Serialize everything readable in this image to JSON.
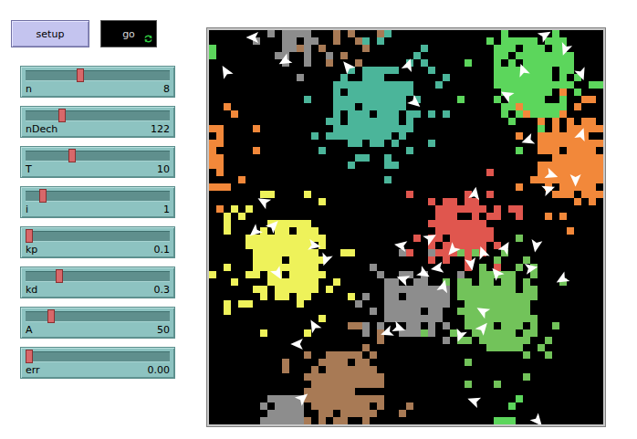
{
  "buttons": [
    {
      "label": "setup",
      "kind": "once",
      "pressed": false
    },
    {
      "label": "go",
      "kind": "forever",
      "pressed": true
    }
  ],
  "sliders": [
    {
      "label": "n",
      "value": "8",
      "level": 0.37
    },
    {
      "label": "nDech",
      "value": "122",
      "level": 0.24
    },
    {
      "label": "T",
      "value": "10",
      "level": 0.31
    },
    {
      "label": "i",
      "value": "1",
      "level": 0.1
    },
    {
      "label": "kp",
      "value": "0.1",
      "level": 0.0
    },
    {
      "label": "kd",
      "value": "0.3",
      "level": 0.22
    },
    {
      "label": "A",
      "value": "50",
      "level": 0.16
    },
    {
      "label": "err",
      "value": "0.00",
      "level": 0.0
    }
  ],
  "world": {
    "clusters": [
      {
        "color": "#8d8d8d",
        "center": [
          11,
          1
        ],
        "radius": 3
      },
      {
        "color": "#4bb59a",
        "center": [
          22,
          10
        ],
        "radius": 6
      },
      {
        "color": "#5cd65c",
        "center": [
          44,
          5.5
        ],
        "radius": 6
      },
      {
        "color": "#f2883a",
        "center": [
          49.5,
          17
        ],
        "radius": 6
      },
      {
        "color": "#eef25a",
        "center": [
          10,
          31
        ],
        "radius": 6
      },
      {
        "color": "#e0564e",
        "center": [
          34,
          27
        ],
        "radius": 5
      },
      {
        "color": "#8d8d8d",
        "center": [
          28,
          37
        ],
        "radius": 4.5
      },
      {
        "color": "#72c35a",
        "center": [
          39,
          37.5
        ],
        "radius": 6
      },
      {
        "color": "#a87a55",
        "center": [
          18,
          49
        ],
        "radius": 5.5
      },
      {
        "color": "#8d8d8d",
        "center": [
          10,
          51.5
        ],
        "radius": 3
      },
      {
        "color": "#5cd65c",
        "center": [
          40,
          53.5
        ],
        "radius": 2
      }
    ],
    "turtles": [
      {
        "x": 6,
        "y": 1,
        "heading": 270
      },
      {
        "x": 10.4,
        "y": 4.2,
        "heading": 240
      },
      {
        "x": 2.3,
        "y": 5.7,
        "heading": 330
      },
      {
        "x": 19,
        "y": 5,
        "heading": 320
      },
      {
        "x": 27.3,
        "y": 4.8,
        "heading": 20
      },
      {
        "x": 28.2,
        "y": 9.9,
        "heading": 130
      },
      {
        "x": 46,
        "y": 0.7,
        "heading": 60
      },
      {
        "x": 48.8,
        "y": 2.6,
        "heading": 200
      },
      {
        "x": 43,
        "y": 5.5,
        "heading": 340
      },
      {
        "x": 51,
        "y": 6,
        "heading": 160
      },
      {
        "x": 40.8,
        "y": 8.9,
        "heading": 300
      },
      {
        "x": 43.7,
        "y": 15.1,
        "heading": 250
      },
      {
        "x": 51,
        "y": 14.3,
        "heading": 20
      },
      {
        "x": 46.9,
        "y": 19.8,
        "heading": 110
      },
      {
        "x": 50.2,
        "y": 20.5,
        "heading": 180
      },
      {
        "x": 46.5,
        "y": 21.8,
        "heading": 70
      },
      {
        "x": 36.4,
        "y": 22.4,
        "heading": 10
      },
      {
        "x": 7.5,
        "y": 23.5,
        "heading": 300
      },
      {
        "x": 8.8,
        "y": 26.8,
        "heading": 45
      },
      {
        "x": 6.3,
        "y": 27.6,
        "heading": 230
      },
      {
        "x": 14.4,
        "y": 29.5,
        "heading": 100
      },
      {
        "x": 16,
        "y": 31.4,
        "heading": 200
      },
      {
        "x": 9.4,
        "y": 33.3,
        "heading": 150
      },
      {
        "x": 26.3,
        "y": 29.5,
        "heading": 280
      },
      {
        "x": 30.3,
        "y": 28.5,
        "heading": 60
      },
      {
        "x": 33.4,
        "y": 30.1,
        "heading": 220
      },
      {
        "x": 37.5,
        "y": 30.5,
        "heading": 340
      },
      {
        "x": 40.6,
        "y": 29.8,
        "heading": 30
      },
      {
        "x": 44.8,
        "y": 29.5,
        "heading": 190
      },
      {
        "x": 31.3,
        "y": 32.6,
        "heading": 260
      },
      {
        "x": 29.4,
        "y": 33.3,
        "heading": 120
      },
      {
        "x": 26.6,
        "y": 34.1,
        "heading": 290
      },
      {
        "x": 32.1,
        "y": 35.1,
        "heading": 15
      },
      {
        "x": 35.9,
        "y": 32,
        "heading": 170
      },
      {
        "x": 39.4,
        "y": 33.3,
        "heading": 320
      },
      {
        "x": 44.1,
        "y": 32.6,
        "heading": 80
      },
      {
        "x": 48.4,
        "y": 34.1,
        "heading": 240
      },
      {
        "x": 34.4,
        "y": 41.8,
        "heading": 200
      },
      {
        "x": 37.5,
        "y": 40.8,
        "heading": 40
      },
      {
        "x": 37.5,
        "y": 38.5,
        "heading": 300
      },
      {
        "x": 26,
        "y": 40.8,
        "heading": 110
      },
      {
        "x": 24.4,
        "y": 41.4,
        "heading": 250
      },
      {
        "x": 14.4,
        "y": 40.5,
        "heading": 330
      },
      {
        "x": 12.1,
        "y": 43,
        "heading": 270
      },
      {
        "x": 12.8,
        "y": 50.4,
        "heading": 50
      },
      {
        "x": 36.3,
        "y": 50.8,
        "heading": 290
      },
      {
        "x": 45,
        "y": 53.5,
        "heading": 140
      }
    ]
  }
}
